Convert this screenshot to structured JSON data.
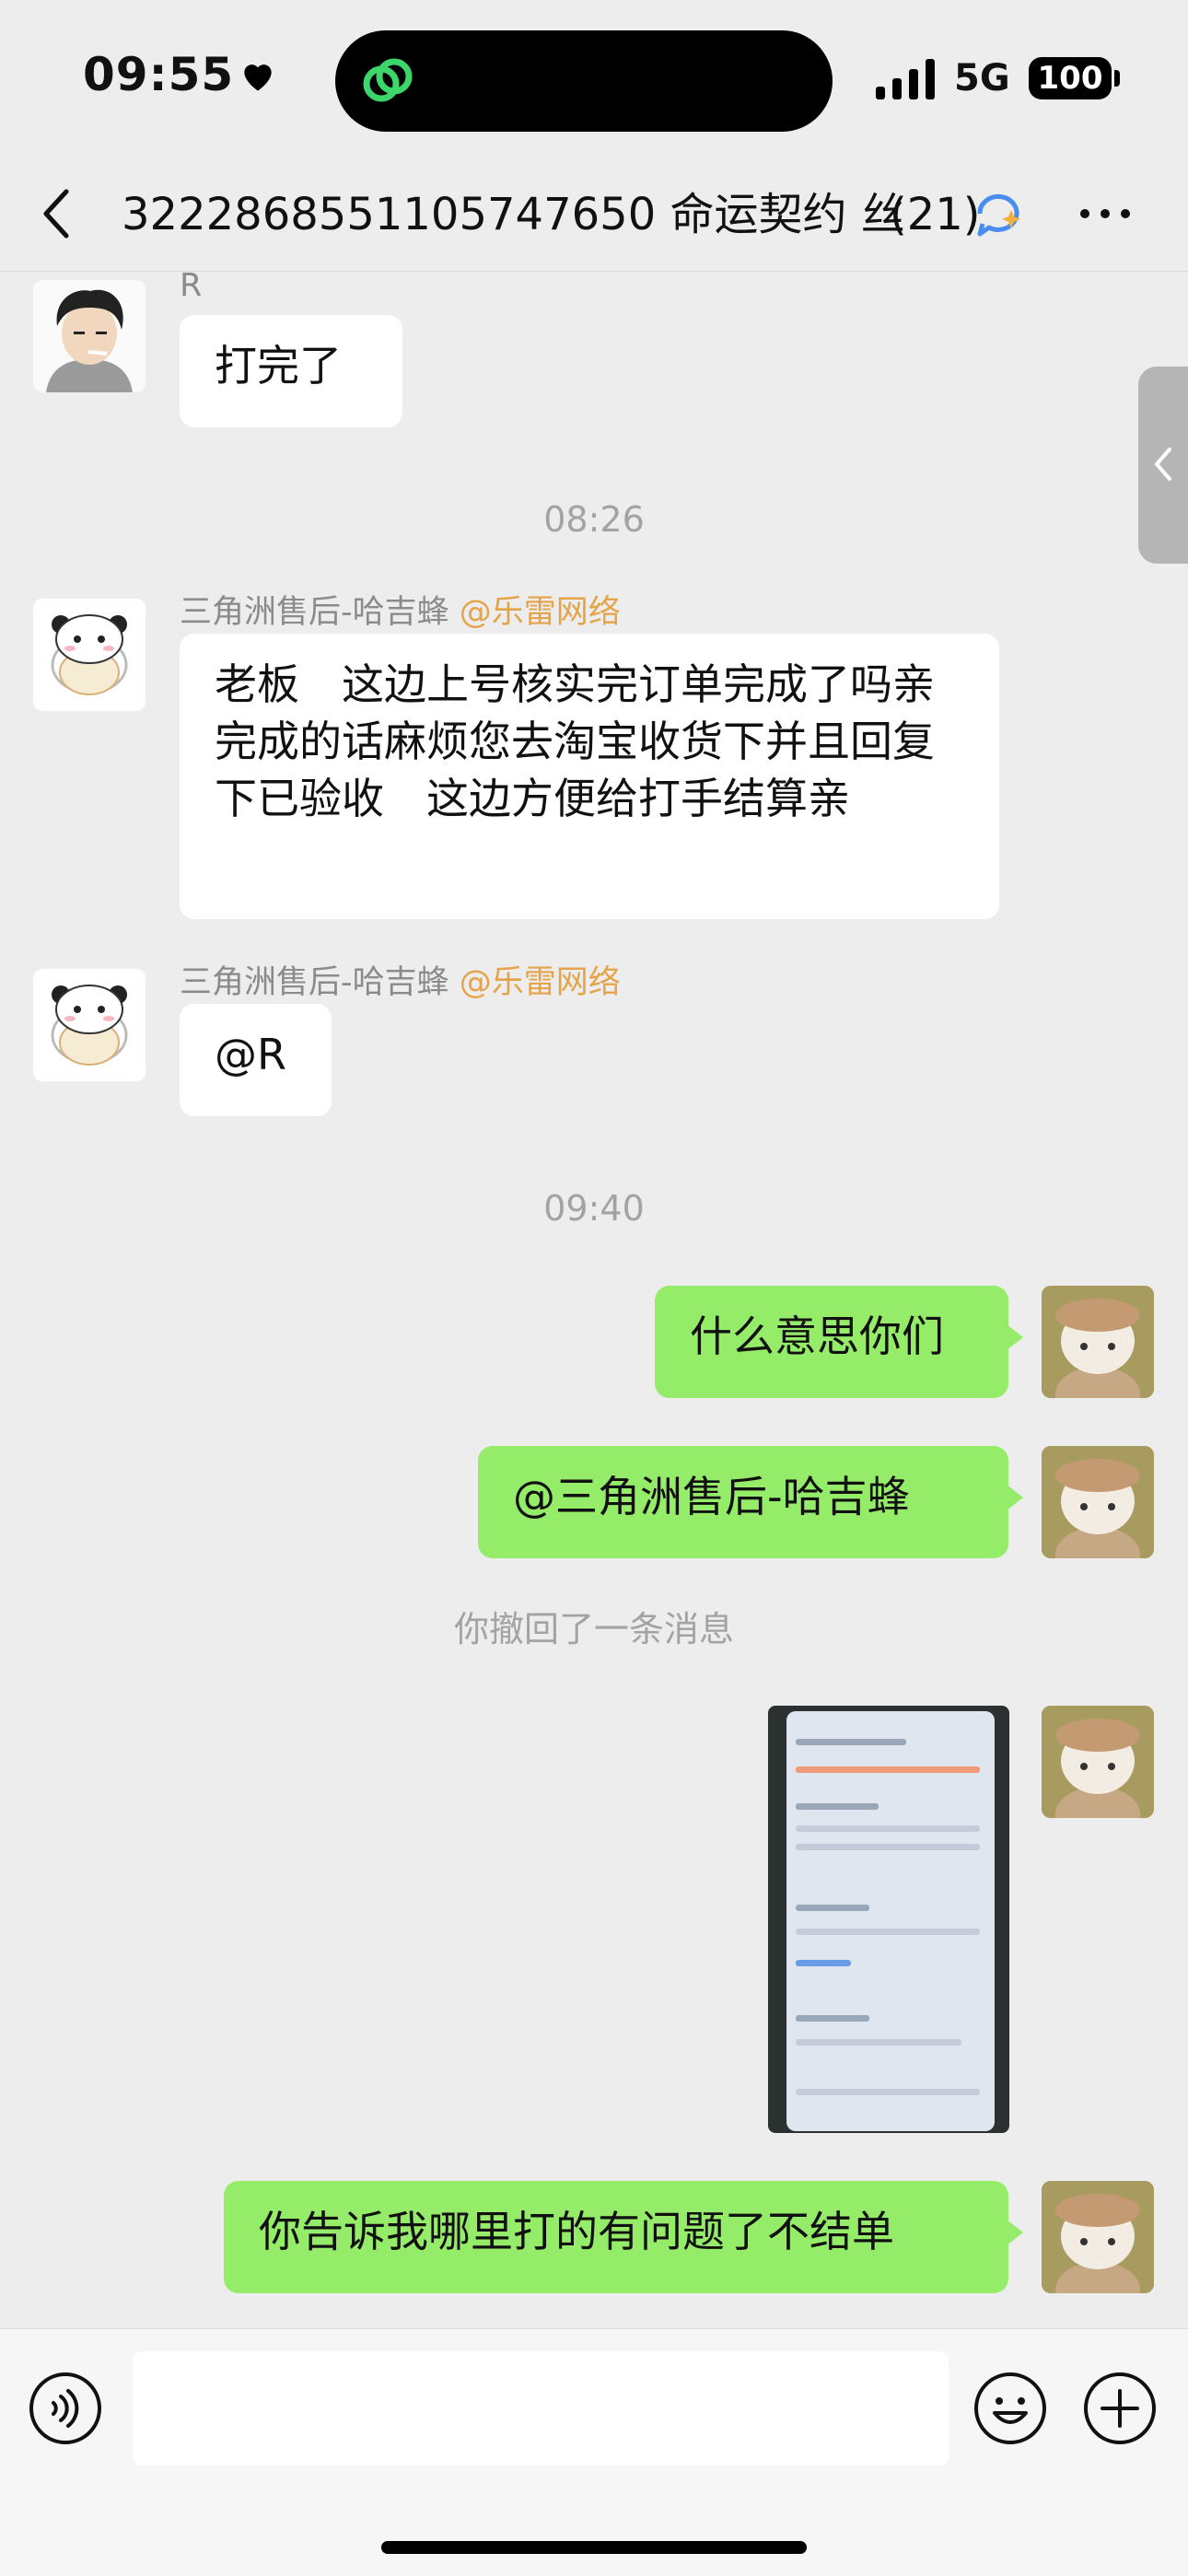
{
  "status": {
    "time": "09:55",
    "network": "5G",
    "battery": "100"
  },
  "header": {
    "title": "3222868551105747650 命运契约 丝",
    "count": "(21)"
  },
  "messages": {
    "m1": {
      "sender": "R",
      "text": "打完了"
    },
    "t1": "08:26",
    "m2": {
      "sender": "三角洲售后-哈吉蜂",
      "org": "@乐雷网络",
      "text": "老板　这边上号核实完订单完成了吗亲　完成的话麻烦您去淘宝收货下并且回复下已验收　这边方便给打手结算亲"
    },
    "m3": {
      "sender": "三角洲售后-哈吉蜂",
      "org": "@乐雷网络",
      "text": "@R"
    },
    "t2": "09:40",
    "o1": "什么意思你们",
    "o2": "@三角洲售后-哈吉蜂",
    "recall": "你撤回了一条消息",
    "o3": "你告诉我哪里打的有问题了不结单"
  },
  "input": {
    "placeholder": ""
  },
  "colors": {
    "bubble_out": "#95ec69",
    "org_mention": "#e5a449",
    "background": "#ededed"
  }
}
